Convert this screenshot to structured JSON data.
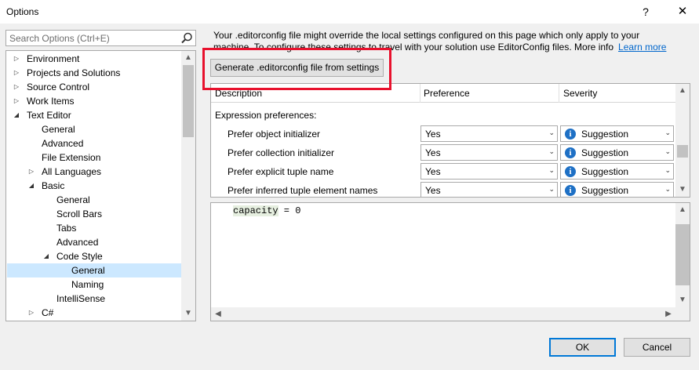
{
  "window": {
    "title": "Options",
    "help": "?",
    "close": "✕"
  },
  "search": {
    "placeholder": "Search Options (Ctrl+E)"
  },
  "tree": {
    "items": [
      {
        "label": "Environment",
        "arrow": "▷"
      },
      {
        "label": "Projects and Solutions",
        "arrow": "▷"
      },
      {
        "label": "Source Control",
        "arrow": "▷"
      },
      {
        "label": "Work Items",
        "arrow": "▷"
      },
      {
        "label": "Text Editor",
        "arrow": "◢"
      },
      {
        "label": "General"
      },
      {
        "label": "Advanced"
      },
      {
        "label": "File Extension"
      },
      {
        "label": "All Languages",
        "arrow": "▷"
      },
      {
        "label": "Basic",
        "arrow": "◢"
      },
      {
        "label": "General"
      },
      {
        "label": "Scroll Bars"
      },
      {
        "label": "Tabs"
      },
      {
        "label": "Advanced"
      },
      {
        "label": "Code Style",
        "arrow": "◢"
      },
      {
        "label": "General"
      },
      {
        "label": "Naming"
      },
      {
        "label": "IntelliSense"
      },
      {
        "label": "C#",
        "arrow": "▷"
      }
    ]
  },
  "info": {
    "line1": "Your .editorconfig file might override the local settings configured on this page which only apply to your",
    "line2": "machine. To configure these settings to travel with your solution use EditorConfig files. More info",
    "link": "Learn more"
  },
  "generate_button": "Generate .editorconfig file from settings",
  "grid": {
    "headers": {
      "description": "Description",
      "preference": "Preference",
      "severity": "Severity"
    },
    "group": "Expression preferences:",
    "rows": [
      {
        "label": "Prefer object initializer",
        "preference": "Yes",
        "severity": "Suggestion"
      },
      {
        "label": "Prefer collection initializer",
        "preference": "Yes",
        "severity": "Suggestion"
      },
      {
        "label": "Prefer explicit tuple name",
        "preference": "Yes",
        "severity": "Suggestion"
      },
      {
        "label": "Prefer inferred tuple element names",
        "preference": "Yes",
        "severity": "Suggestion"
      }
    ]
  },
  "preview": {
    "code_var": "capacity",
    "code_rest": " = 0"
  },
  "buttons": {
    "ok": "OK",
    "cancel": "Cancel"
  },
  "icons": {
    "info": "i",
    "chevron": "⌄",
    "up": "▲",
    "down": "▼",
    "left": "◀",
    "right": "▶"
  },
  "colors": {
    "highlight": "#e8112d",
    "selection": "#cce8ff",
    "link": "#0066cc",
    "info_icon": "#1e70c5"
  }
}
